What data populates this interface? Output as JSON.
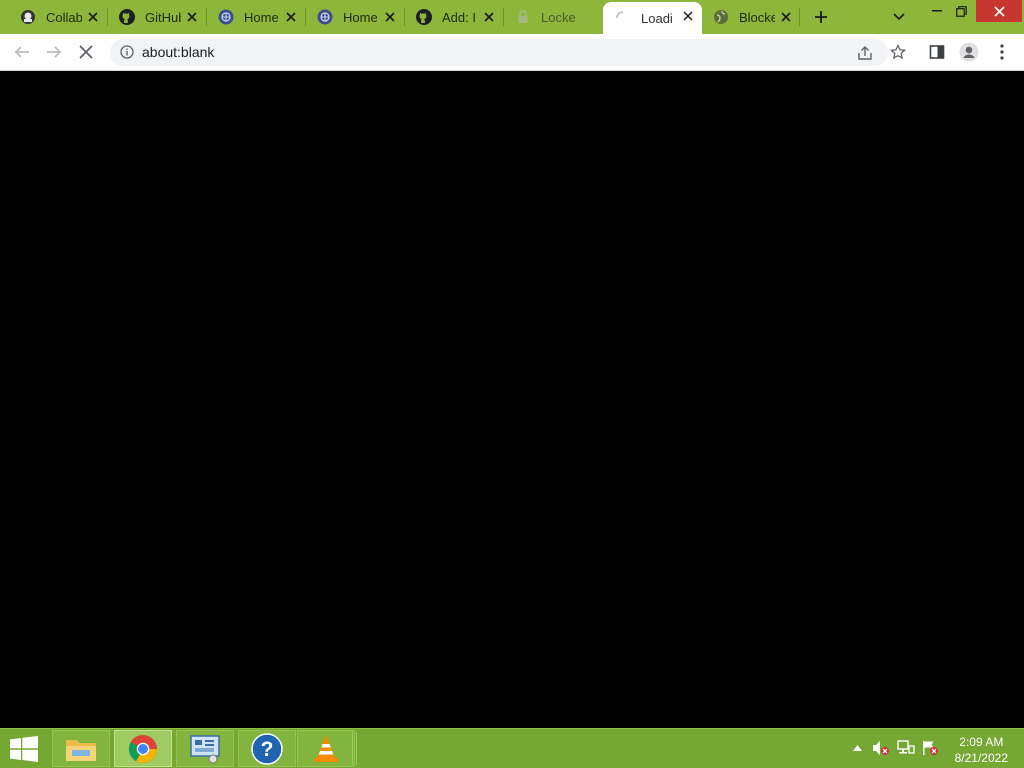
{
  "browser": {
    "tabs": [
      {
        "title": "Collab",
        "icon": "colab-icon"
      },
      {
        "title": "GitHub",
        "icon": "github-icon"
      },
      {
        "title": "Home",
        "icon": "globe-icon"
      },
      {
        "title": "Home",
        "icon": "globe-icon"
      },
      {
        "title": "Add: I",
        "icon": "github-icon"
      },
      {
        "title": "Locke",
        "icon": "lock-icon"
      },
      {
        "title": "Loadi",
        "icon": "loading-spinner-icon"
      },
      {
        "title": "Blocke",
        "icon": "globe-icon"
      }
    ],
    "active_tab_index": 6,
    "url": "about:blank"
  },
  "colors": {
    "tabstrip": "#8db63b",
    "taskbar": "#75a733",
    "content": "#000000"
  },
  "taskbar": {
    "apps": [
      "file-explorer-icon",
      "chrome-icon",
      "control-panel-icon",
      "help-icon",
      "vlc-icon"
    ],
    "active_app": "chrome-icon",
    "clock": {
      "time": "2:09 AM",
      "date": "8/21/2022"
    }
  }
}
